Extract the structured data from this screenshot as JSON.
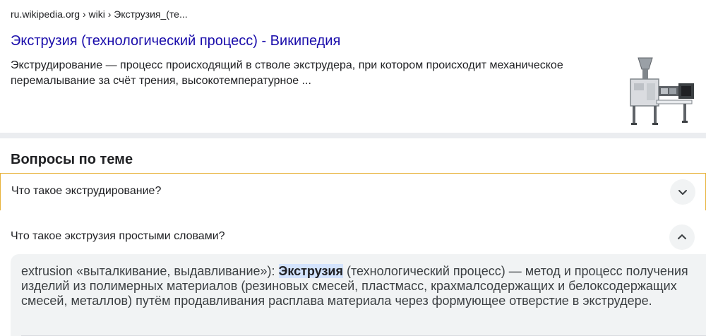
{
  "result": {
    "breadcrumb": "ru.wikipedia.org › wiki › Экструзия_(те...",
    "title": "Экструзия (технологический процесс) - Википедия",
    "snippet": "Экструдирование — процесс происходящий в стволе экструдера, при котором происходит механическое перемалывание за счёт трения, высокотемпературное ...",
    "thumbnail_icon": "extruder-machine-image"
  },
  "people_also_ask": {
    "heading": "Вопросы по теме",
    "questions": [
      {
        "text": "Что такое экструдирование?",
        "state": "collapsed",
        "icon": "chevron-down-icon"
      },
      {
        "text": "Что такое экструзия простыми словами?",
        "state": "expanded",
        "icon": "chevron-up-icon",
        "answer": {
          "before": "extrusion «выталкивание, выдавливание»): ",
          "highlight": "Экструзия",
          "after": " (технологический процесс) — метод и процесс получения изделий из полимерных материалов (резиновых смесей, пластмасс, крахмалсодержащих и белоксодержащих смесей, металлов) путём продавливания расплава материала через формующее отверстие в экструдере."
        }
      }
    ]
  },
  "colors": {
    "link": "#1a0dab",
    "focus_border": "#e8b23a",
    "highlight": "#d3e3fd",
    "answer_bg": "#f1f3f4",
    "separator": "#ebedf0"
  }
}
